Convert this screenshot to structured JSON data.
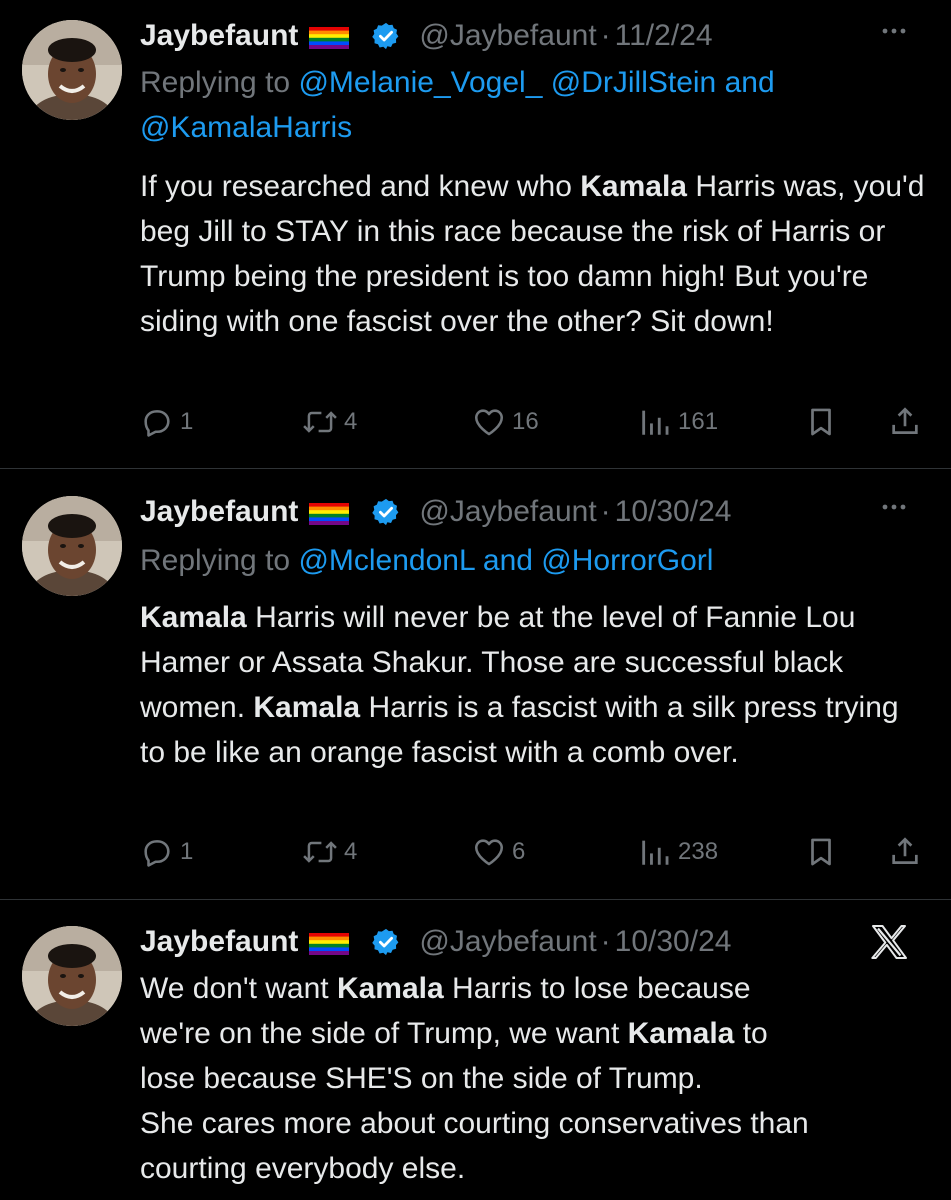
{
  "tweets": [
    {
      "name": "Jaybefaunt",
      "handle": "@Jaybefaunt",
      "separator": "·",
      "date": "11/2/24",
      "reply_prefix": "Replying to",
      "reply_mentions": [
        "@Melanie_Vogel_",
        "@DrJillStein",
        "and",
        "@KamalaHarris"
      ],
      "body_parts": [
        {
          "text": "If you researched and knew who ",
          "bold": false
        },
        {
          "text": "Kamala",
          "bold": true
        },
        {
          "text": " Harris was, you'd beg Jill to STAY in this race because the risk of Harris or Trump being the president is too damn high! But you're siding with one fascist over the other? Sit down!",
          "bold": false
        }
      ],
      "stats": {
        "replies": "1",
        "reposts": "4",
        "likes": "16",
        "views": "161"
      }
    },
    {
      "name": "Jaybefaunt",
      "handle": "@Jaybefaunt",
      "separator": "·",
      "date": "10/30/24",
      "reply_prefix": "Replying to",
      "reply_mentions": [
        "@MclendonL",
        "and",
        "@HorrorGorl"
      ],
      "body_parts": [
        {
          "text": "Kamala",
          "bold": true
        },
        {
          "text": " Harris will never be at the level of  Fannie Lou Hamer or Assata Shakur. Those are successful black women. ",
          "bold": false
        },
        {
          "text": "Kamala",
          "bold": true
        },
        {
          "text": " Harris is a fascist with a silk press trying to be like an orange fascist with a comb over.",
          "bold": false
        }
      ],
      "stats": {
        "replies": "1",
        "reposts": "4",
        "likes": "6",
        "views": "238"
      }
    },
    {
      "name": "Jaybefaunt",
      "handle": "@Jaybefaunt",
      "separator": "·",
      "date": "10/30/24",
      "body_lines": [
        [
          {
            "text": "We don't want ",
            "bold": false
          },
          {
            "text": "Kamala",
            "bold": true
          },
          {
            "text": " Harris to lose because",
            "bold": false
          }
        ],
        [
          {
            "text": "we're on the side of Trump, we want ",
            "bold": false
          },
          {
            "text": "Kamala",
            "bold": true
          },
          {
            "text": " to",
            "bold": false
          }
        ],
        [
          {
            "text": "lose because SHE'S on the side of Trump.",
            "bold": false
          }
        ],
        [
          {
            "text": "She cares more about courting conservatives than",
            "bold": false
          }
        ],
        [
          {
            "text": "courting everybody else.",
            "bold": false
          }
        ]
      ]
    }
  ],
  "icons": {
    "reply": "reply-bubble-icon",
    "repost": "repost-arrows-icon",
    "like": "heart-icon",
    "views": "bar-chart-icon",
    "bookmark": "bookmark-icon",
    "share": "share-upload-icon",
    "more": "more-dots-icon",
    "verified": "verified-badge-icon",
    "flag": "rainbow-flag-icon",
    "platform": "x-logo-icon"
  },
  "colors": {
    "background": "#000000",
    "text": "#e7e9ea",
    "muted": "#71767b",
    "link": "#1d9bf0",
    "verified": "#1d9bf0",
    "divider": "#2f3336"
  }
}
